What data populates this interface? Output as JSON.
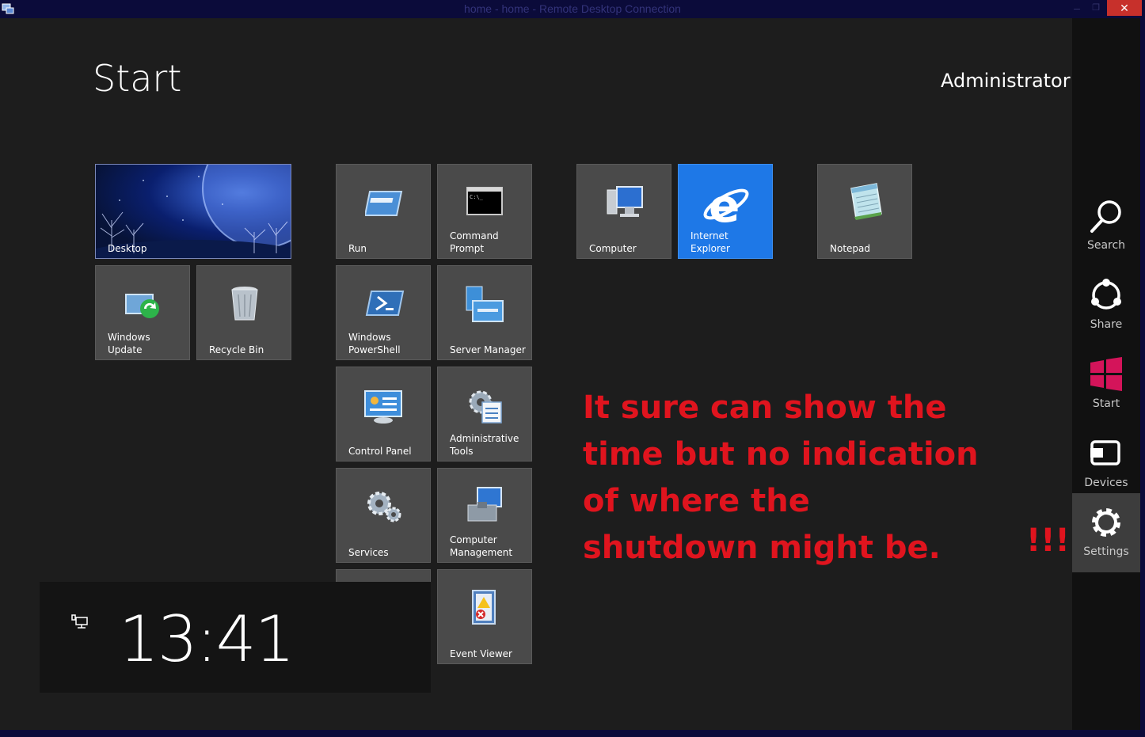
{
  "window": {
    "title": "home - home - Remote Desktop Connection",
    "minimize_glyph": "–",
    "maximize_glyph": "❐",
    "close_glyph": "✕"
  },
  "start": {
    "title": "Start",
    "user": "Administrator"
  },
  "tiles": {
    "desktop": "Desktop",
    "windows_update": "Windows Update",
    "recycle_bin": "Recycle Bin",
    "run": "Run",
    "command_prompt": "Command Prompt",
    "windows_powershell": "Windows PowerShell",
    "server_manager": "Server Manager",
    "control_panel": "Control Panel",
    "administrative_tools": "Administrative Tools",
    "services": "Services",
    "computer_management": "Computer Management",
    "event_viewer": "Event Viewer",
    "computer": "Computer",
    "internet_explorer": "Internet Explorer",
    "notepad": "Notepad"
  },
  "clock": {
    "time": "13:41"
  },
  "annotation": {
    "text": "It sure can show the time but no indication of where the shutdown might be.",
    "exclaim": "!!!"
  },
  "charms": {
    "search": "Search",
    "share": "Share",
    "start": "Start",
    "devices": "Devices",
    "settings": "Settings",
    "active": "Settings"
  },
  "colors": {
    "background": "#1d1d1d",
    "tile": "#4a4a4a",
    "ie_tile": "#1e78e7",
    "annotation": "#e0141e",
    "titlebar": "#0b0b3a",
    "close_button": "#c7302b",
    "start_charm": "#d4145a"
  }
}
